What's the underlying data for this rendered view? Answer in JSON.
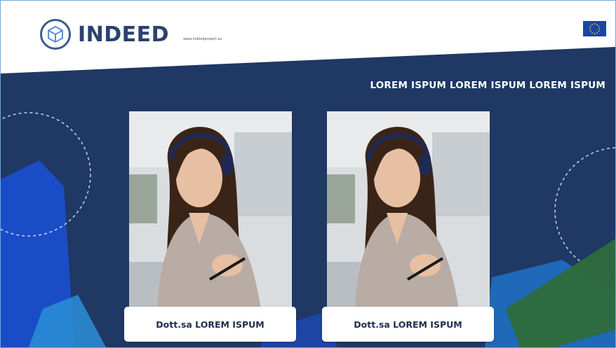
{
  "header": {
    "brand": "INDEED",
    "website": "www.indeedproject.eu",
    "logo_icon": "cube-logo-icon",
    "flag_icon": "eu-flag-icon"
  },
  "main": {
    "headline": "LOREM ISPUM LOREM ISPUM LOREM ISPUM",
    "speakers": [
      {
        "name": "Dott.sa LOREM ISPUM",
        "photo_icon": "woman-headphones-photo"
      },
      {
        "name": "Dott.sa LOREM ISPUM",
        "photo_icon": "woman-headphones-photo"
      }
    ]
  },
  "colors": {
    "background": "#1f3864",
    "brand_text": "#2b4170",
    "accent_blue": "#1b4fd1",
    "accent_green": "#2e6b3a"
  }
}
